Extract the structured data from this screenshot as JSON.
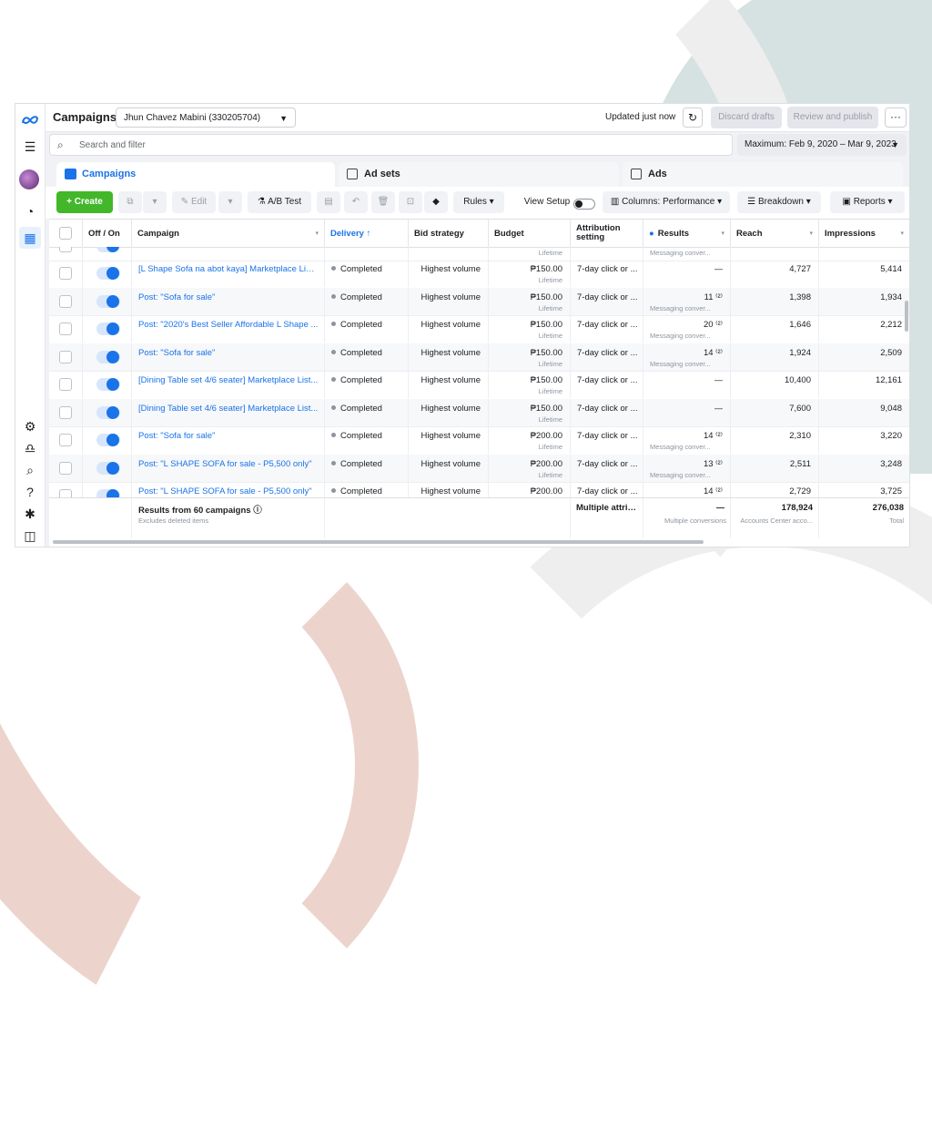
{
  "topbar": {
    "title": "Campaigns",
    "account": "Jhun Chavez Mabini (330205704)",
    "updated": "Updated just now",
    "discard": "Discard drafts",
    "review": "Review and publish",
    "more": "···"
  },
  "search": {
    "placeholder": "Search and filter",
    "daterange": "Maximum: Feb 9, 2020 – Mar 9, 2023"
  },
  "tabs": [
    {
      "label": "Campaigns"
    },
    {
      "label": "Ad sets"
    },
    {
      "label": "Ads"
    }
  ],
  "toolbar": {
    "create": "Create",
    "edit": "Edit",
    "abtest": "A/B Test",
    "rules": "Rules",
    "view_setup": "View Setup",
    "columns": "Columns: Performance",
    "breakdown": "Breakdown",
    "reports": "Reports"
  },
  "columns": {
    "offon": "Off / On",
    "campaign": "Campaign",
    "delivery": "Delivery ↑",
    "bid": "Bid strategy",
    "budget": "Budget",
    "attribution": "Attribution setting",
    "results": "Results",
    "reach": "Reach",
    "impressions": "Impressions"
  },
  "partial_row": {
    "budget_sub": "Lifetime",
    "results_sub": "Messaging conver..."
  },
  "rows": [
    {
      "name": "[L Shape Sofa na abot kaya] Marketplace Listi...",
      "delivery": "Completed",
      "bid": "Highest volume",
      "budget": "₱150.00",
      "budget_sub": "Lifetime",
      "attribution": "7-day click or ...",
      "results": "—",
      "results_sub": "",
      "reach": "4,727",
      "impressions": "5,414"
    },
    {
      "name": "Post: \"Sofa for sale\"",
      "delivery": "Completed",
      "bid": "Highest volume",
      "budget": "₱150.00",
      "budget_sub": "Lifetime",
      "attribution": "7-day click or ...",
      "results": "11 ⁽²⁾",
      "results_sub": "Messaging conver...",
      "reach": "1,398",
      "impressions": "1,934"
    },
    {
      "name": "Post: \"2020's Best Seller Affordable L Shape ...",
      "delivery": "Completed",
      "bid": "Highest volume",
      "budget": "₱150.00",
      "budget_sub": "Lifetime",
      "attribution": "7-day click or ...",
      "results": "20 ⁽²⁾",
      "results_sub": "Messaging conver...",
      "reach": "1,646",
      "impressions": "2,212"
    },
    {
      "name": "Post: \"Sofa for sale\"",
      "delivery": "Completed",
      "bid": "Highest volume",
      "budget": "₱150.00",
      "budget_sub": "Lifetime",
      "attribution": "7-day click or ...",
      "results": "14 ⁽²⁾",
      "results_sub": "Messaging conver...",
      "reach": "1,924",
      "impressions": "2,509"
    },
    {
      "name": "[Dining Table set 4/6 seater] Marketplace List...",
      "delivery": "Completed",
      "bid": "Highest volume",
      "budget": "₱150.00",
      "budget_sub": "Lifetime",
      "attribution": "7-day click or ...",
      "results": "—",
      "results_sub": "",
      "reach": "10,400",
      "impressions": "12,161"
    },
    {
      "name": "[Dining Table set 4/6 seater] Marketplace List...",
      "delivery": "Completed",
      "bid": "Highest volume",
      "budget": "₱150.00",
      "budget_sub": "Lifetime",
      "attribution": "7-day click or ...",
      "results": "—",
      "results_sub": "",
      "reach": "7,600",
      "impressions": "9,048"
    },
    {
      "name": "Post: \"Sofa for sale\"",
      "delivery": "Completed",
      "bid": "Highest volume",
      "budget": "₱200.00",
      "budget_sub": "Lifetime",
      "attribution": "7-day click or ...",
      "results": "14 ⁽²⁾",
      "results_sub": "Messaging conver...",
      "reach": "2,310",
      "impressions": "3,220"
    },
    {
      "name": "Post: \"L SHAPE SOFA for sale - P5,500 only\"",
      "delivery": "Completed",
      "bid": "Highest volume",
      "budget": "₱200.00",
      "budget_sub": "Lifetime",
      "attribution": "7-day click or ...",
      "results": "13 ⁽²⁾",
      "results_sub": "Messaging conver...",
      "reach": "2,511",
      "impressions": "3,248"
    },
    {
      "name": "Post: \"L SHAPE SOFA for sale - P5,500 only\"",
      "delivery": "Completed",
      "bid": "Highest volume",
      "budget": "₱200.00",
      "budget_sub": "",
      "attribution": "7-day click or ...",
      "results": "14 ⁽²⁾",
      "results_sub": "",
      "reach": "2,729",
      "impressions": "3,725"
    }
  ],
  "footer": {
    "summary": "Results from 60 campaigns",
    "summary_sub": "Excludes deleted items",
    "attribution": "Multiple attrib...",
    "results": "—",
    "results_sub": "Multiple conversions",
    "reach": "178,924",
    "reach_sub": "Accounts Center acco...",
    "impressions": "276,038",
    "impressions_sub": "Total"
  },
  "icons": {
    "meta": "meta-logo-icon",
    "menu": "menu-icon",
    "gauge": "gauge-icon",
    "grid": "table-icon",
    "settings": "gear-icon",
    "bell": "bell-icon",
    "search": "search-icon",
    "help": "help-icon",
    "bug": "bug-icon",
    "panel": "panel-icon"
  },
  "colors": {
    "accent": "#1a73e8",
    "create": "#42b72a"
  }
}
